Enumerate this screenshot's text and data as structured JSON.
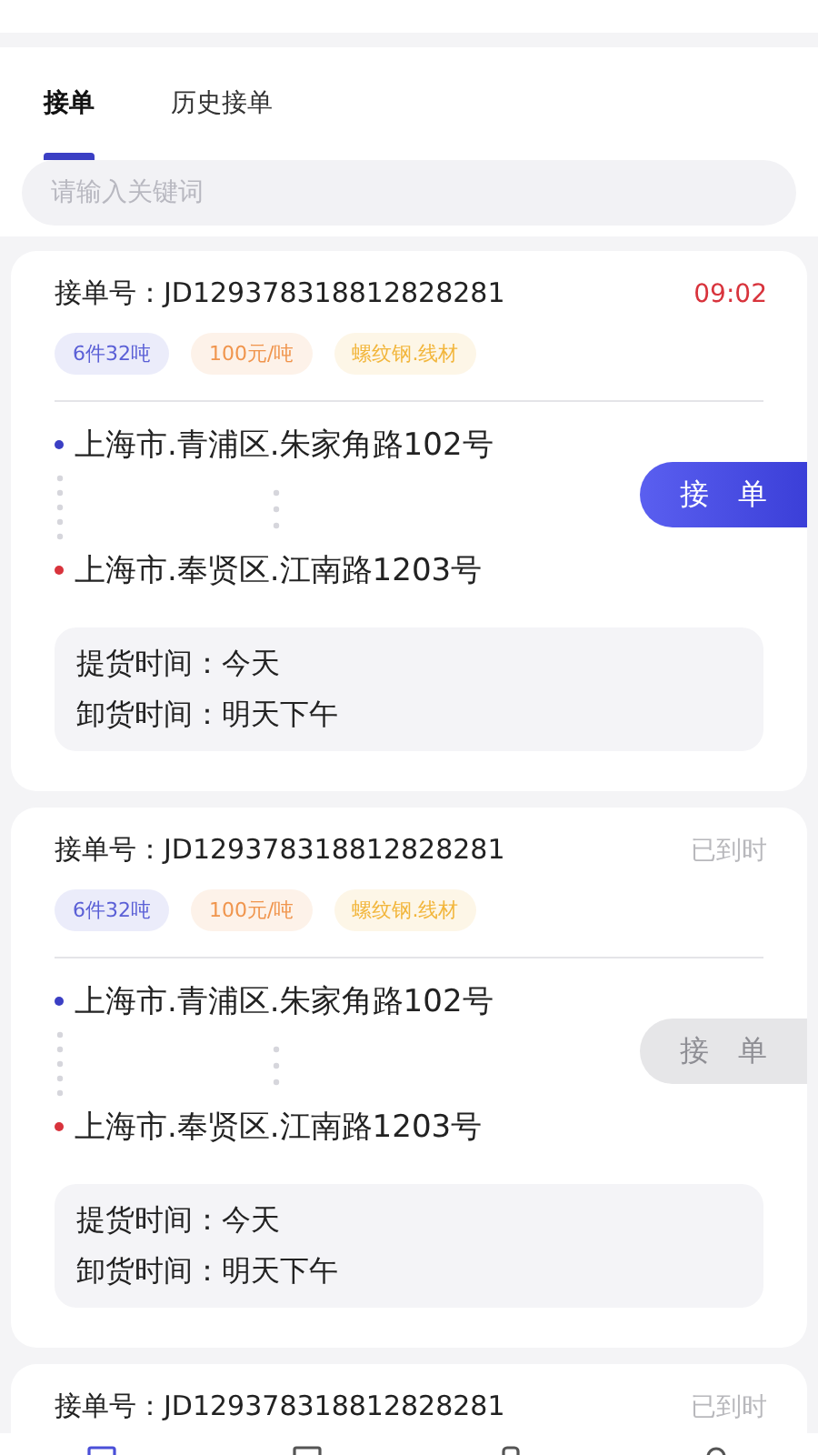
{
  "tabs": [
    {
      "label": "接单",
      "selected": true
    },
    {
      "label": "历史接单",
      "selected": false
    }
  ],
  "search": {
    "placeholder": "请输入关键词"
  },
  "orders": [
    {
      "label": "接单号：",
      "number": "JD129378318812828281",
      "status": {
        "kind": "timer",
        "text": "09:02"
      },
      "tags": [
        {
          "text": "6件32吨",
          "color": "#5a5fd6"
        },
        {
          "text": "100元/吨",
          "color": "#f0954d"
        },
        {
          "text": "螺纹钢.线材",
          "color": "#f2b63c"
        }
      ],
      "from": "上海市.青浦区.朱家角路102号",
      "to": "上海市.奉贤区.江南路1203号",
      "button": {
        "label": "接　单",
        "disabled": false
      },
      "times": [
        "提货时间：今天",
        "卸货时间：明天下午"
      ]
    },
    {
      "label": "接单号：",
      "number": "JD129378318812828281",
      "status": {
        "kind": "expired",
        "text": "已到时"
      },
      "tags": [
        {
          "text": "6件32吨",
          "color": "#5a5fd6"
        },
        {
          "text": "100元/吨",
          "color": "#f0954d"
        },
        {
          "text": "螺纹钢.线材",
          "color": "#f2b63c"
        }
      ],
      "from": "上海市.青浦区.朱家角路102号",
      "to": "上海市.奉贤区.江南路1203号",
      "button": {
        "label": "接　单",
        "disabled": true
      },
      "times": [
        "提货时间：今天",
        "卸货时间：明天下午"
      ]
    },
    {
      "label": "接单号：",
      "number": "JD129378318812828281",
      "status": {
        "kind": "expired",
        "text": "已到时"
      }
    }
  ],
  "nav": [
    {
      "selected": true
    },
    {
      "selected": false
    },
    {
      "selected": false
    },
    {
      "selected": false
    }
  ]
}
